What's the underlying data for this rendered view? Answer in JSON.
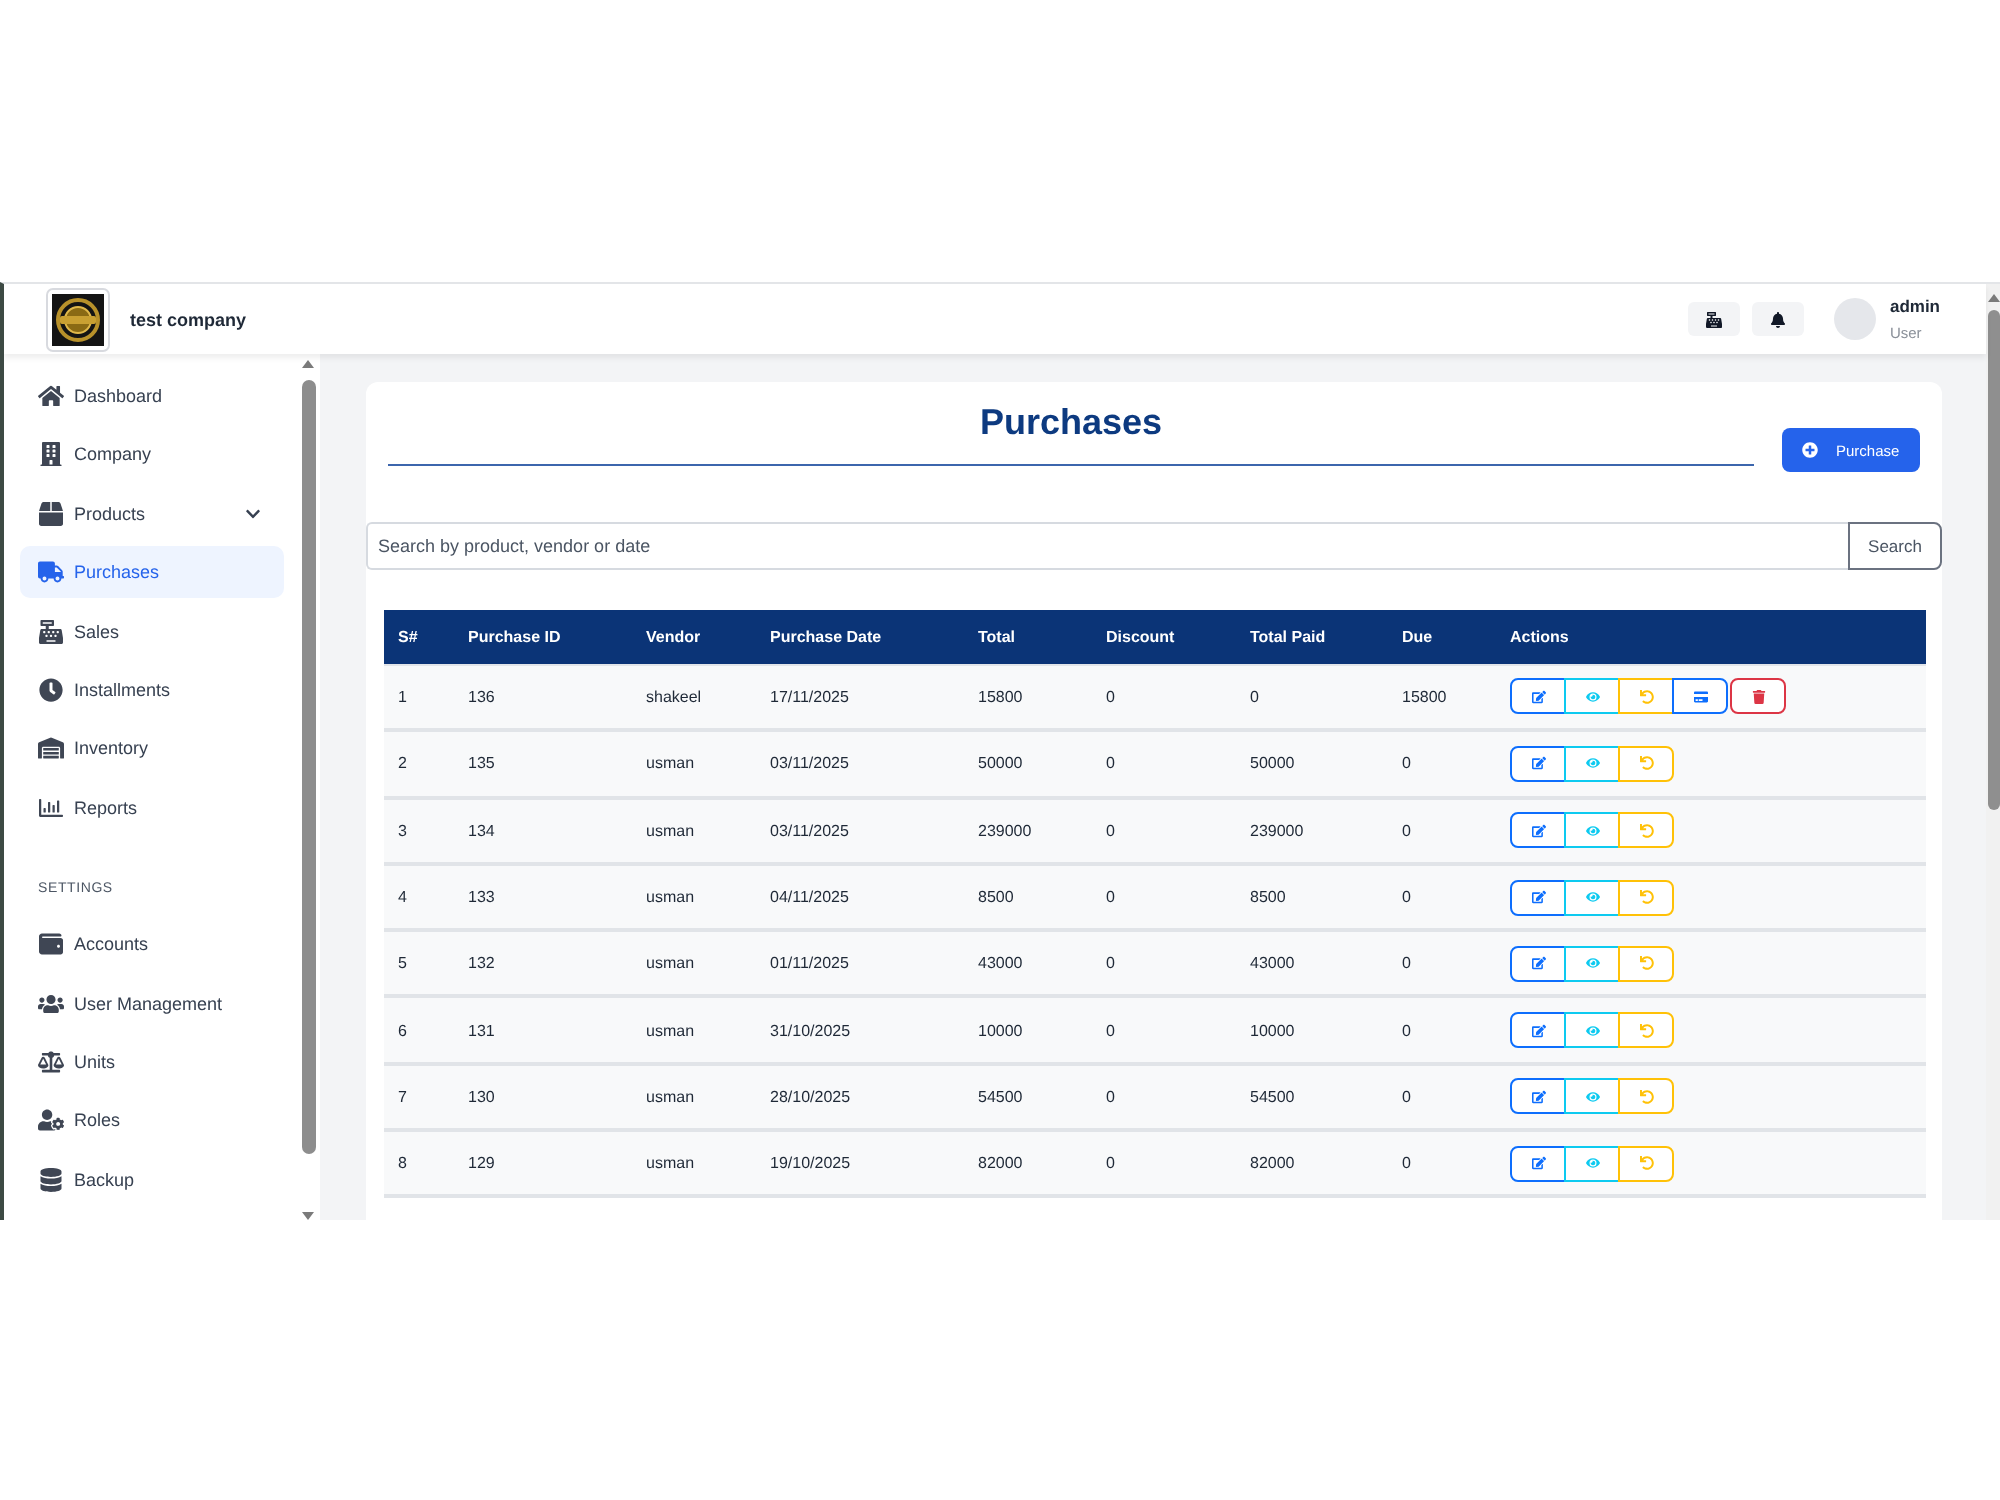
{
  "header": {
    "company_name": "test company",
    "user": {
      "name": "admin",
      "role": "User"
    }
  },
  "sidebar": {
    "sections": [
      {
        "items": [
          {
            "label": "Dashboard",
            "kind": "link",
            "selected": false
          },
          {
            "label": "Company",
            "kind": "link",
            "selected": false
          },
          {
            "label": "Products",
            "kind": "group",
            "expanded": false,
            "selected": false
          },
          {
            "label": "Purchases",
            "kind": "link",
            "selected": true
          },
          {
            "label": "Sales",
            "kind": "link",
            "selected": false
          },
          {
            "label": "Installments",
            "kind": "link",
            "selected": false
          },
          {
            "label": "Inventory",
            "kind": "link",
            "selected": false
          },
          {
            "label": "Reports",
            "kind": "link",
            "selected": false
          }
        ]
      },
      {
        "title": "SETTINGS",
        "items": [
          {
            "label": "Accounts",
            "kind": "link",
            "selected": false
          },
          {
            "label": "User Management",
            "kind": "link",
            "selected": false
          },
          {
            "label": "Units",
            "kind": "link",
            "selected": false
          },
          {
            "label": "Roles",
            "kind": "link",
            "selected": false
          },
          {
            "label": "Backup",
            "kind": "link",
            "selected": false
          }
        ]
      }
    ]
  },
  "page": {
    "title": "Purchases",
    "add_button": "Purchase",
    "search": {
      "placeholder": "Search by product, vendor or date",
      "button": "Search"
    }
  },
  "table": {
    "columns": [
      "S#",
      "Purchase ID",
      "Vendor",
      "Purchase Date",
      "Total",
      "Discount",
      "Total Paid",
      "Due",
      "Actions"
    ],
    "rows": [
      {
        "cells": [
          "1",
          "136",
          "shakeel",
          "17/11/2025",
          "15800",
          "0",
          "0",
          "15800"
        ],
        "actions": [
          {
            "kind": "edit"
          },
          {
            "kind": "view"
          },
          {
            "kind": "return"
          },
          {
            "kind": "pay"
          },
          {
            "kind": "delete"
          }
        ]
      },
      {
        "cells": [
          "2",
          "135",
          "usman",
          "03/11/2025",
          "50000",
          "0",
          "50000",
          "0"
        ],
        "actions": [
          {
            "kind": "edit"
          },
          {
            "kind": "view"
          },
          {
            "kind": "return"
          }
        ]
      },
      {
        "cells": [
          "3",
          "134",
          "usman",
          "03/11/2025",
          "239000",
          "0",
          "239000",
          "0"
        ],
        "actions": [
          {
            "kind": "edit"
          },
          {
            "kind": "view"
          },
          {
            "kind": "return"
          }
        ]
      },
      {
        "cells": [
          "4",
          "133",
          "usman",
          "04/11/2025",
          "8500",
          "0",
          "8500",
          "0"
        ],
        "actions": [
          {
            "kind": "edit"
          },
          {
            "kind": "view"
          },
          {
            "kind": "return"
          }
        ]
      },
      {
        "cells": [
          "5",
          "132",
          "usman",
          "01/11/2025",
          "43000",
          "0",
          "43000",
          "0"
        ],
        "actions": [
          {
            "kind": "edit"
          },
          {
            "kind": "view"
          },
          {
            "kind": "return"
          }
        ]
      },
      {
        "cells": [
          "6",
          "131",
          "usman",
          "31/10/2025",
          "10000",
          "0",
          "10000",
          "0"
        ],
        "actions": [
          {
            "kind": "edit"
          },
          {
            "kind": "view"
          },
          {
            "kind": "return"
          }
        ]
      },
      {
        "cells": [
          "7",
          "130",
          "usman",
          "28/10/2025",
          "54500",
          "0",
          "54500",
          "0"
        ],
        "actions": [
          {
            "kind": "edit"
          },
          {
            "kind": "view"
          },
          {
            "kind": "return"
          }
        ]
      },
      {
        "cells": [
          "8",
          "129",
          "usman",
          "19/10/2025",
          "82000",
          "0",
          "82000",
          "0"
        ],
        "actions": [
          {
            "kind": "edit"
          },
          {
            "kind": "view"
          },
          {
            "kind": "return"
          }
        ]
      }
    ]
  }
}
